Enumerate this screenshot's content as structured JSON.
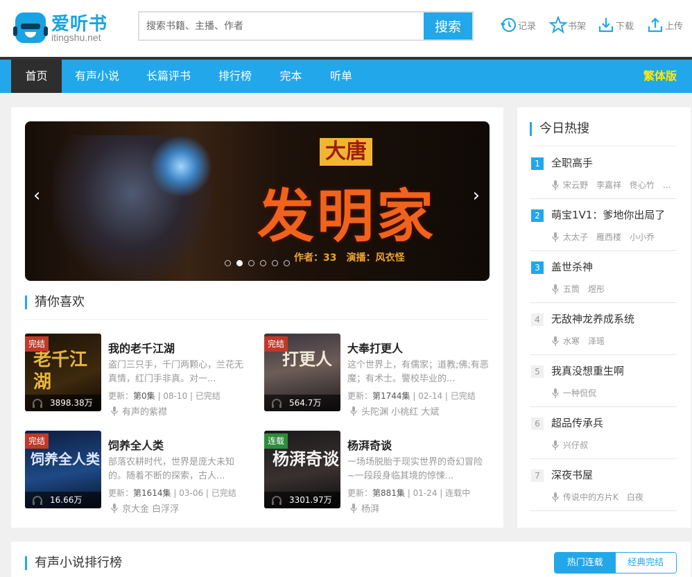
{
  "logo": {
    "name": "爱听书",
    "sub": "itingshu.net"
  },
  "search": {
    "placeholder": "搜索书籍、主播、作者",
    "button": "搜索"
  },
  "toolbar": [
    {
      "label": "记录",
      "icon": "history-clock-icon"
    },
    {
      "label": "书架",
      "icon": "star-icon"
    },
    {
      "label": "下载",
      "icon": "download-icon"
    },
    {
      "label": "上传",
      "icon": "upload-icon"
    }
  ],
  "nav": {
    "items": [
      "首页",
      "有声小说",
      "长篇评书",
      "排行榜",
      "完本",
      "听单"
    ],
    "active": "首页",
    "traditional": "繁体版"
  },
  "banner": {
    "title_top": "大唐",
    "title_main": "发明家",
    "credit": "作者：33　演播：风衣怪",
    "slides": 6,
    "active_slide": 2
  },
  "guess": {
    "title": "猜你喜欢",
    "books": [
      {
        "title": "我的老千江湖",
        "tag": "完结",
        "tag_color": "#c0392b",
        "plays": "3898.38万",
        "cover_text": "老千江湖",
        "desc": "盗门三只手，千门两颗心，兰花无真情，红门手非真。对一...",
        "meta_prefix": "更新：",
        "episodes": "第0集",
        "meta_suffix": " | 08-10 | 已完结",
        "anchors": "有声的紫襟"
      },
      {
        "title": "大奉打更人",
        "tag": "完结",
        "tag_color": "#c0392b",
        "plays": "564.7万",
        "cover_text": "打更人",
        "desc": "这个世界上，有儒家；道教;佛;有恶魔；有术士。警校毕业的...",
        "meta_prefix": "更新：",
        "episodes": "第1744集",
        "meta_suffix": " | 02-14 | 已完结",
        "anchors": "头陀渊 小桃红 大斌"
      },
      {
        "title": "饲养全人类",
        "tag": "完结",
        "tag_color": "#c0392b",
        "plays": "16.66万",
        "cover_text": "饲养全人类",
        "desc": "部落农耕时代，世界是庞大未知的。随着不断的探索，古人...",
        "meta_prefix": "更新：",
        "episodes": "第1614集",
        "meta_suffix": " | 03-06 | 已完结",
        "anchors": "京大金 白浮浮"
      },
      {
        "title": "杨湃奇谈",
        "tag": "连载",
        "tag_color": "#2e8b3e",
        "plays": "3301.97万",
        "cover_text": "杨湃奇谈",
        "desc": "一场场脱胎于现实世界的奇幻冒险~一段段身临其境的惊悚...",
        "meta_prefix": "更新：",
        "episodes": "第881集",
        "meta_suffix": " | 01-24 | 连载中",
        "anchors": "杨湃"
      }
    ]
  },
  "hot": {
    "title": "今日热搜",
    "items": [
      {
        "rank": "1",
        "name": "全职高手",
        "anchors": "宋云野　李嘉祥　佟心竹　..."
      },
      {
        "rank": "2",
        "name": "萌宝1V1：爹地你出局了",
        "anchors": "太太子　雁西楼　小小乔"
      },
      {
        "rank": "3",
        "name": "盖世杀神",
        "anchors": "五筒　煜彤"
      },
      {
        "rank": "4",
        "name": "无敌神龙养成系统",
        "anchors": "水寒　泽瑶"
      },
      {
        "rank": "5",
        "name": "我真没想重生啊",
        "anchors": "一种侃侃"
      },
      {
        "rank": "6",
        "name": "超品传承兵",
        "anchors": "兴仔叔"
      },
      {
        "rank": "7",
        "name": "深夜书屋",
        "anchors": "传说中的方片K　白夜"
      }
    ]
  },
  "ranking": {
    "title": "有声小说排行榜",
    "tabs": [
      "热门连载",
      "经典完结"
    ],
    "active_tab": "热门连载"
  },
  "colors": {
    "accent": "#21a7ea",
    "nav_dark": "#2e2e2e",
    "traditional": "#ffea00"
  }
}
